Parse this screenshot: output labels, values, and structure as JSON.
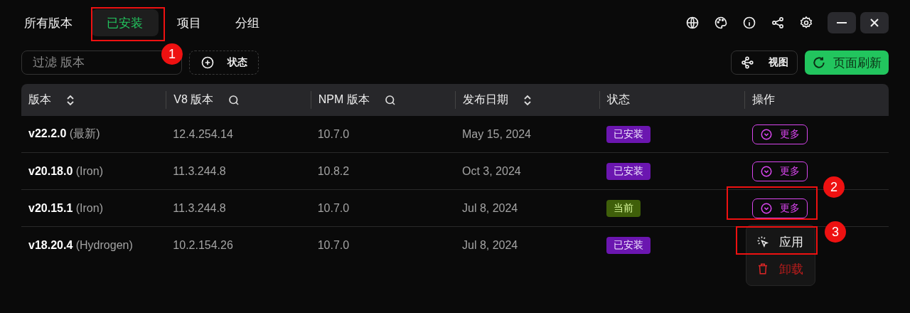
{
  "tabs": [
    {
      "label": "所有版本",
      "selected": false
    },
    {
      "label": "已安装",
      "selected": true
    },
    {
      "label": "项目",
      "selected": false
    },
    {
      "label": "分组",
      "selected": false
    }
  ],
  "filter": {
    "placeholder": "过滤 版本"
  },
  "status_filter": {
    "label": "状态"
  },
  "view_button": {
    "label": "视图"
  },
  "refresh_button": {
    "label": "页面刷新"
  },
  "table": {
    "columns": [
      {
        "label": "版本",
        "kind": "sortable"
      },
      {
        "label": "V8 版本",
        "kind": "searchable"
      },
      {
        "label": "NPM 版本",
        "kind": "searchable"
      },
      {
        "label": "发布日期",
        "kind": "sortable"
      },
      {
        "label": "状态",
        "kind": "plain"
      },
      {
        "label": "操作",
        "kind": "plain"
      }
    ],
    "rows": [
      {
        "version": "v22.2.0",
        "codename": "(最新)",
        "v8": "12.4.254.14",
        "npm": "10.7.0",
        "date": "May 15, 2024",
        "status": {
          "label": "已安装",
          "kind": "installed"
        },
        "action": "更多"
      },
      {
        "version": "v20.18.0",
        "codename": "(Iron)",
        "v8": "11.3.244.8",
        "npm": "10.8.2",
        "date": "Oct 3, 2024",
        "status": {
          "label": "已安装",
          "kind": "installed"
        },
        "action": "更多"
      },
      {
        "version": "v20.15.1",
        "codename": "(Iron)",
        "v8": "11.3.244.8",
        "npm": "10.7.0",
        "date": "Jul 8, 2024",
        "status": {
          "label": "当前",
          "kind": "current"
        },
        "action": "更多"
      },
      {
        "version": "v18.20.4",
        "codename": "(Hydrogen)",
        "v8": "10.2.154.26",
        "npm": "10.7.0",
        "date": "Jul 8, 2024",
        "status": {
          "label": "已安装",
          "kind": "installed"
        }
      }
    ]
  },
  "menu": {
    "items": [
      {
        "label": "应用",
        "kind": "apply"
      },
      {
        "label": "卸载",
        "kind": "delete"
      }
    ]
  },
  "callouts": [
    "1",
    "2",
    "3"
  ]
}
